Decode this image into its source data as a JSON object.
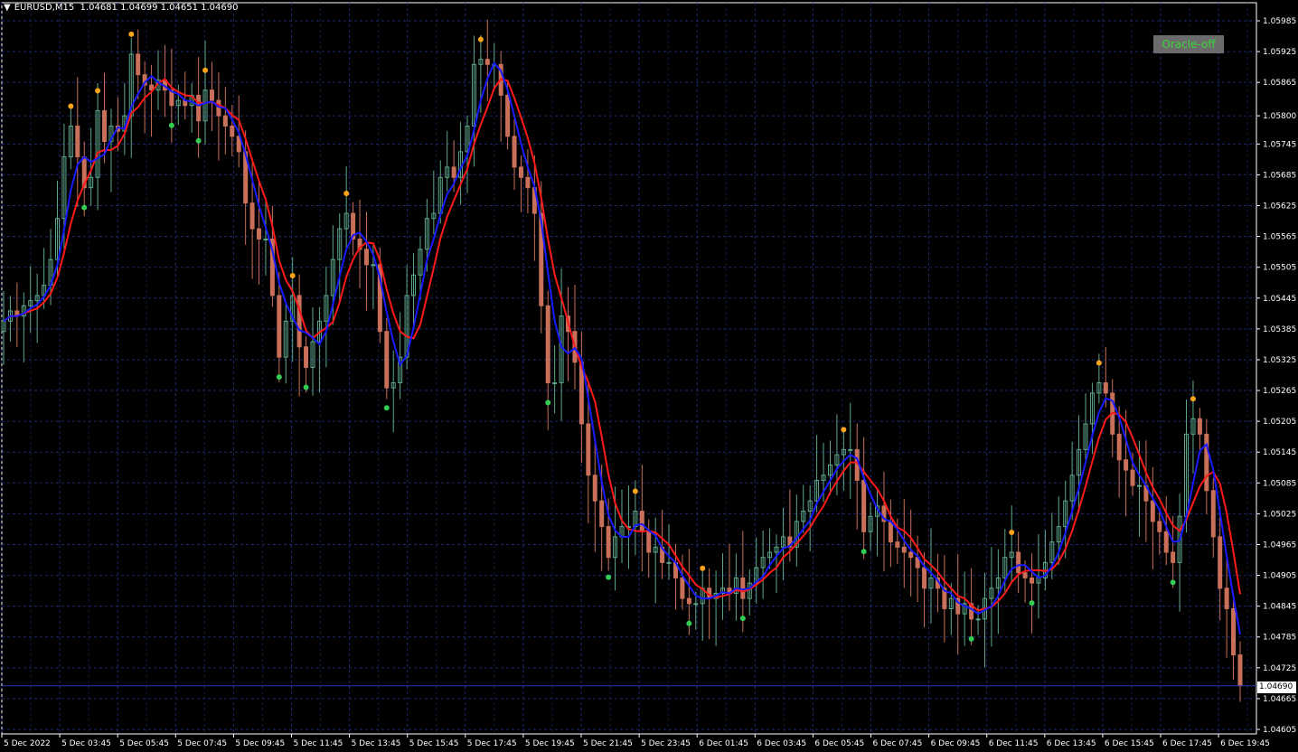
{
  "header": {
    "symbol": "EURUSD,M15",
    "ohlc": "1.04681 1.04699 1.04651 1.04690"
  },
  "oracle_button": {
    "label": "Oracle-off"
  },
  "current_price": {
    "label": "1.04690",
    "value": 1.0469
  },
  "colors": {
    "background": "#000000",
    "grid": "#1e2a6e",
    "axis": "#ffffff",
    "bull_candle": "#5fa88a",
    "bear_candle": "#c8705a",
    "fast_ma": "#1a1aff",
    "slow_ma": "#ff1a1a",
    "top_marker": "#ffa31a",
    "bottom_marker": "#33cc55",
    "price_line": "#2a3ab8"
  },
  "chart_data": {
    "type": "candlestick",
    "price_axis_labels": [
      "1.05985",
      "1.05925",
      "1.05865",
      "1.05800",
      "1.05745",
      "1.05685",
      "1.05625",
      "1.05565",
      "1.05505",
      "1.05445",
      "1.05385",
      "1.05325",
      "1.05265",
      "1.05205",
      "1.05145",
      "1.05085",
      "1.05025",
      "1.04965",
      "1.04905",
      "1.04845",
      "1.04785",
      "1.04725",
      "1.04665",
      "1.04605"
    ],
    "time_axis_labels": [
      "5 Dec 2022",
      "5 Dec 03:45",
      "5 Dec 05:45",
      "5 Dec 07:45",
      "5 Dec 09:45",
      "5 Dec 11:45",
      "5 Dec 13:45",
      "5 Dec 15:45",
      "5 Dec 17:45",
      "5 Dec 19:45",
      "5 Dec 21:45",
      "5 Dec 23:45",
      "6 Dec 01:45",
      "6 Dec 03:45",
      "6 Dec 05:45",
      "6 Dec 07:45",
      "6 Dec 09:45",
      "6 Dec 11:45",
      "6 Dec 13:45",
      "6 Dec 15:45",
      "6 Dec 17:45",
      "6 Dec 19:45"
    ],
    "closes": [
      1.054,
      1.0542,
      1.0541,
      1.0543,
      1.0544,
      1.0545,
      1.0547,
      1.0552,
      1.056,
      1.0572,
      1.0578,
      1.0572,
      1.0566,
      1.0568,
      1.0581,
      1.0575,
      1.0578,
      1.0577,
      1.058,
      1.0592,
      1.0588,
      1.0586,
      1.0585,
      1.0587,
      1.0585,
      1.0582,
      1.0583,
      1.0582,
      1.0584,
      1.0579,
      1.0585,
      1.0583,
      1.058,
      1.0578,
      1.0576,
      1.0573,
      1.0563,
      1.0558,
      1.0556,
      1.0556,
      1.0545,
      1.0533,
      1.054,
      1.0545,
      1.0535,
      1.0531,
      1.0536,
      1.054,
      1.0545,
      1.0552,
      1.0558,
      1.0561,
      1.0556,
      1.0554,
      1.0551,
      1.0551,
      1.0538,
      1.0527,
      1.0528,
      1.0533,
      1.0545,
      1.0549,
      1.0554,
      1.056,
      1.0561,
      1.0568,
      1.057,
      1.0568,
      1.0573,
      1.0578,
      1.059,
      1.0591,
      1.059,
      1.059,
      1.0584,
      1.0576,
      1.057,
      1.0568,
      1.0566,
      1.0561,
      1.0543,
      1.0528,
      1.0528,
      1.0541,
      1.0538,
      1.0532,
      1.052,
      1.051,
      1.0505,
      1.05,
      1.0494,
      1.0498,
      1.05,
      1.05,
      1.0503,
      1.0499,
      1.0495,
      1.0496,
      1.0493,
      1.0493,
      1.049,
      1.0486,
      1.0485,
      1.0485,
      1.0488,
      1.0486,
      1.0487,
      1.0488,
      1.0487,
      1.049,
      1.0486,
      1.0489,
      1.0492,
      1.0494,
      1.0495,
      1.0496,
      1.0498,
      1.0496,
      1.0501,
      1.0503,
      1.0505,
      1.0509,
      1.051,
      1.0512,
      1.0514,
      1.0515,
      1.0515,
      1.0509,
      1.0499,
      1.0502,
      1.0504,
      1.0501,
      1.0497,
      1.0496,
      1.0495,
      1.0494,
      1.0492,
      1.0488,
      1.049,
      1.0488,
      1.0484,
      1.0486,
      1.0483,
      1.0485,
      1.0482,
      1.0482,
      1.0486,
      1.0488,
      1.049,
      1.0494,
      1.0495,
      1.0491,
      1.049,
      1.0489,
      1.049,
      1.0493,
      1.0497,
      1.05,
      1.0505,
      1.051,
      1.0515,
      1.052,
      1.0526,
      1.0528,
      1.0526,
      1.0518,
      1.0513,
      1.0511,
      1.0508,
      1.0508,
      1.0505,
      1.0501,
      1.0499,
      1.0495,
      1.0493,
      1.0502,
      1.0518,
      1.0521,
      1.0518,
      1.0507,
      1.0498,
      1.0488,
      1.0484,
      1.0475,
      1.0469
    ]
  }
}
